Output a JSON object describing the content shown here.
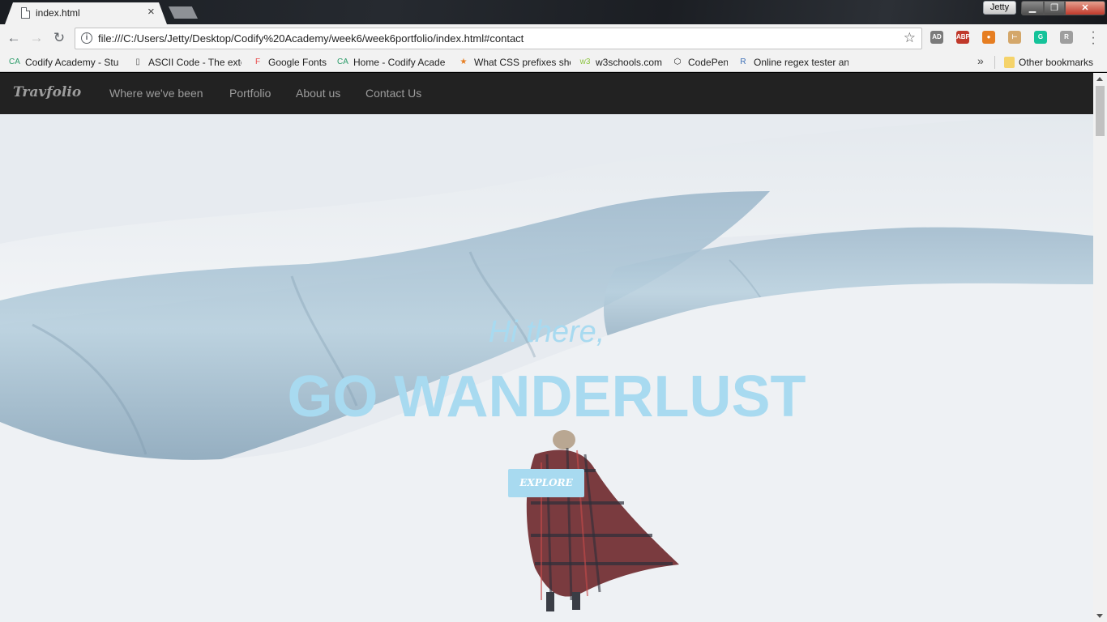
{
  "browser": {
    "tab_title": "index.html",
    "tab_close": "×",
    "profile_name": "Jetty",
    "window_min": "▁",
    "window_max": "❐",
    "window_close": "✕",
    "nav_back": "←",
    "nav_forward": "→",
    "nav_reload": "↻",
    "info_glyph": "i",
    "star_glyph": "☆",
    "address": "file:///C:/Users/Jetty/Desktop/Codify%20Academy/week6/week6portfolio/index.html#contact",
    "extensions": [
      {
        "name": "adblock-icon",
        "label": "AD",
        "color": "#7a7a7a"
      },
      {
        "name": "abp-icon",
        "label": "ABP",
        "color": "#c0392b"
      },
      {
        "name": "color-wheel-icon",
        "label": "●",
        "color": "#e67e22"
      },
      {
        "name": "ruler-icon",
        "label": "⊢",
        "color": "#d4a76a"
      },
      {
        "name": "grammarly-icon",
        "label": "G",
        "color": "#15c39a"
      },
      {
        "name": "extension-r-icon",
        "label": "R",
        "color": "#9e9e9e"
      }
    ]
  },
  "bookmarks": {
    "items": [
      {
        "icon": "CA",
        "label": "Codify Academy - Stu",
        "color": "#2c9c6a"
      },
      {
        "icon": "▯",
        "label": "ASCII Code - The exte",
        "color": "#555"
      },
      {
        "icon": "F",
        "label": "Google Fonts",
        "color": "#e94b4b"
      },
      {
        "icon": "CA",
        "label": "Home - Codify Acade",
        "color": "#2c9c6a"
      },
      {
        "icon": "★",
        "label": "What CSS prefixes sho",
        "color": "#e67e22"
      },
      {
        "icon": "w3",
        "label": "w3schools.com",
        "color": "#8cc43f"
      },
      {
        "icon": "⬡",
        "label": "CodePen",
        "color": "#222"
      },
      {
        "icon": "R",
        "label": "Online regex tester an",
        "color": "#3a6db5"
      }
    ],
    "more": "»",
    "other": "Other bookmarks"
  },
  "site": {
    "brand": "Travfolio",
    "nav": [
      "Where we've been",
      "Portfolio",
      "About us",
      "Contact Us"
    ],
    "hero": {
      "greeting": "Hi there,",
      "title": "GO WANDERLUST",
      "button": "EXPLORE"
    }
  },
  "colors": {
    "navbar_bg": "#222222",
    "nav_text": "#9d9d9d",
    "hero_accent": "#a8daf0"
  }
}
